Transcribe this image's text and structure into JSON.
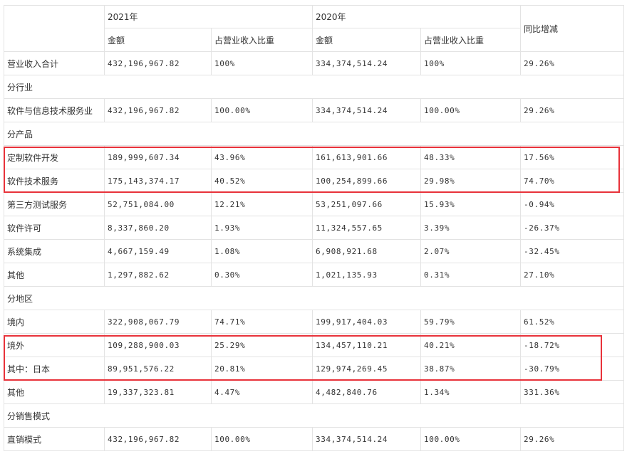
{
  "header": {
    "year_2021": "2021年",
    "year_2020": "2020年",
    "yoy": "同比增减",
    "amount": "金额",
    "ratio": "占营业收入比重"
  },
  "rows": [
    {
      "type": "data",
      "label": "营业收入合计",
      "a21": "432,196,967.82",
      "r21": "100%",
      "a20": "334,374,514.24",
      "r20": "100%",
      "yoy": "29.26%"
    },
    {
      "type": "section",
      "label": "分行业"
    },
    {
      "type": "data",
      "label": "软件与信息技术服务业",
      "a21": "432,196,967.82",
      "r21": "100.00%",
      "a20": "334,374,514.24",
      "r20": "100.00%",
      "yoy": "29.26%"
    },
    {
      "type": "section",
      "label": "分产品"
    },
    {
      "type": "data",
      "label": "定制软件开发",
      "a21": "189,999,607.34",
      "r21": "43.96%",
      "a20": "161,613,901.66",
      "r20": "48.33%",
      "yoy": "17.56%"
    },
    {
      "type": "data",
      "label": "软件技术服务",
      "a21": "175,143,374.17",
      "r21": "40.52%",
      "a20": "100,254,899.66",
      "r20": "29.98%",
      "yoy": "74.70%"
    },
    {
      "type": "data",
      "label": "第三方测试服务",
      "a21": "52,751,084.00",
      "r21": "12.21%",
      "a20": "53,251,097.66",
      "r20": "15.93%",
      "yoy": "-0.94%"
    },
    {
      "type": "data",
      "label": "软件许可",
      "a21": "8,337,860.20",
      "r21": "1.93%",
      "a20": "11,324,557.65",
      "r20": "3.39%",
      "yoy": "-26.37%"
    },
    {
      "type": "data",
      "label": "系统集成",
      "a21": "4,667,159.49",
      "r21": "1.08%",
      "a20": "6,908,921.68",
      "r20": "2.07%",
      "yoy": "-32.45%"
    },
    {
      "type": "data",
      "label": "其他",
      "a21": "1,297,882.62",
      "r21": "0.30%",
      "a20": "1,021,135.93",
      "r20": "0.31%",
      "yoy": "27.10%"
    },
    {
      "type": "section",
      "label": "分地区"
    },
    {
      "type": "data",
      "label": "境内",
      "a21": "322,908,067.79",
      "r21": "74.71%",
      "a20": "199,917,404.03",
      "r20": "59.79%",
      "yoy": "61.52%"
    },
    {
      "type": "data",
      "label": "境外",
      "a21": "109,288,900.03",
      "r21": "25.29%",
      "a20": "134,457,110.21",
      "r20": "40.21%",
      "yoy": "-18.72%"
    },
    {
      "type": "data",
      "label": "其中：日本",
      "a21": "89,951,576.22",
      "r21": "20.81%",
      "a20": "129,974,269.45",
      "r20": "38.87%",
      "yoy": "-30.79%"
    },
    {
      "type": "data",
      "label": "其他",
      "a21": "19,337,323.81",
      "r21": "4.47%",
      "a20": "4,482,840.76",
      "r20": "1.34%",
      "yoy": "331.36%"
    },
    {
      "type": "section",
      "label": "分销售模式"
    },
    {
      "type": "data",
      "label": "直销模式",
      "a21": "432,196,967.82",
      "r21": "100.00%",
      "a20": "334,374,514.24",
      "r20": "100.00%",
      "yoy": "29.26%"
    }
  ],
  "highlight_color": "#e8323a"
}
